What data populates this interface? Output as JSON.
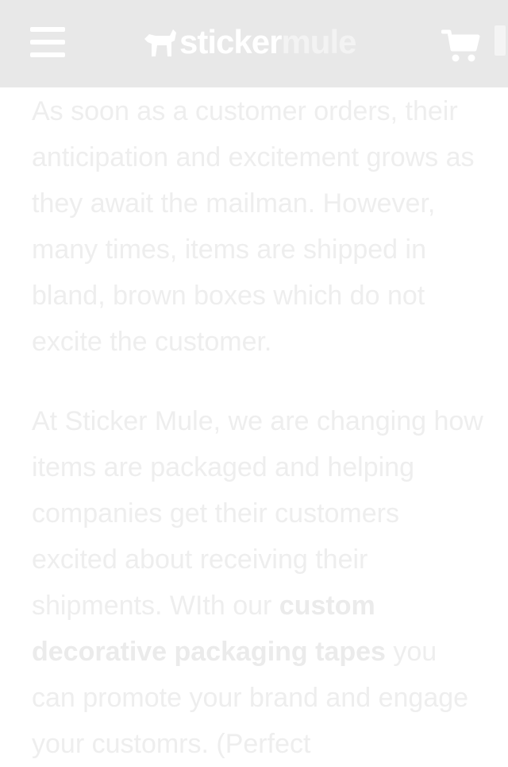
{
  "header": {
    "logo_word_1": "sticker",
    "logo_word_2": "mule",
    "menu_icon": "hamburger-menu-icon",
    "cart_icon": "shopping-cart-icon",
    "logo_icon": "mule-icon"
  },
  "article": {
    "paragraph_1": "As soon as a customer orders, their anticipation and excitement grows as they await the mailman. However, many times, items are shipped in bland, brown boxes which do not excite the customer.",
    "paragraph_2_start": "At Sticker Mule, we are changing how items are packaged and helping companies get their customers excited about receiving their shipments. WIth our ",
    "paragraph_2_link": "custom decorative packaging tapes",
    "paragraph_2_end": " you can promote your brand and engage your customrs. (Perfect"
  },
  "colors": {
    "header_bg": "#e8e8e8",
    "icon_color": "#ffffff",
    "text_color": "#eeeeee"
  }
}
